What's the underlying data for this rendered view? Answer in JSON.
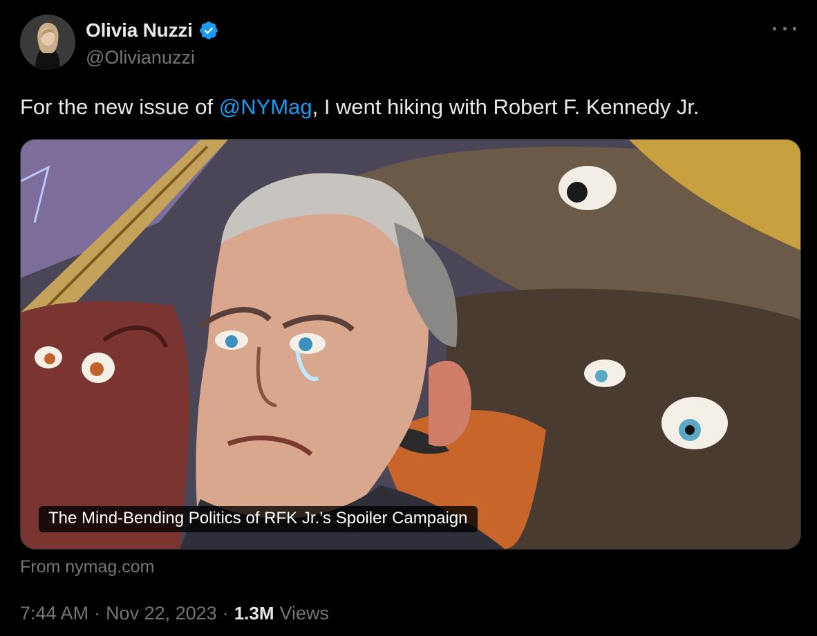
{
  "author": {
    "name": "Olivia Nuzzi",
    "handle": "@Olivianuzzi",
    "verified": true
  },
  "tweet": {
    "text_before": "For the new issue of ",
    "mention": "@NYMag",
    "text_after": ", I went hiking with Robert F. Kennedy Jr."
  },
  "card": {
    "title": "The Mind-Bending Politics of RFK Jr.’s Spoiler Campaign",
    "source": "From nymag.com"
  },
  "meta": {
    "time": "7:44 AM",
    "separator": "·",
    "date": "Nov 22, 2023",
    "views_count": "1.3M",
    "views_label": "Views"
  },
  "colors": {
    "accent": "#1d9bf0",
    "text": "#e7e9ea",
    "secondary": "#71767b",
    "background": "#000000"
  },
  "icons": [
    "verified-badge-icon",
    "more-options-icon"
  ]
}
